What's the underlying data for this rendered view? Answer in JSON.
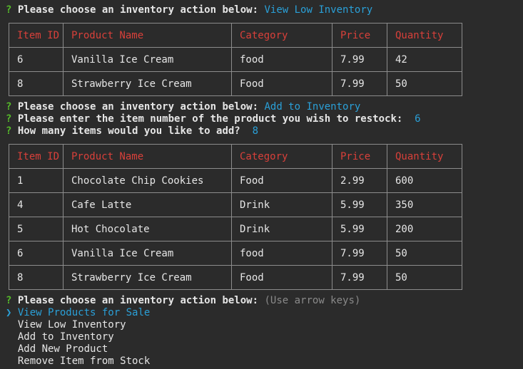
{
  "prompt_mark": "?",
  "selector_mark": "❯",
  "prompt_text": "Please choose an inventory action below:",
  "section1": {
    "answer": "View Low Inventory",
    "table": {
      "headers": [
        "Item ID",
        "Product Name",
        "Category",
        "Price",
        "Quantity"
      ],
      "rows": [
        [
          "6",
          "Vanilla Ice Cream",
          "food",
          "7.99",
          "42"
        ],
        [
          "8",
          "Strawberry Ice Cream",
          "Food",
          "7.99",
          "50"
        ]
      ]
    }
  },
  "section2": {
    "answer": "Add to Inventory",
    "restock_prompt": "Please enter the item number of the product you wish to restock:",
    "restock_answer": "6",
    "add_prompt": "How many items would you like to add?",
    "add_answer": "8",
    "table": {
      "headers": [
        "Item ID",
        "Product Name",
        "Category",
        "Price",
        "Quantity"
      ],
      "rows": [
        [
          "1",
          "Chocolate Chip Cookies",
          "Food",
          "2.99",
          "600"
        ],
        [
          "4",
          "Cafe Latte",
          "Drink",
          "5.99",
          "350"
        ],
        [
          "5",
          "Hot Chocolate",
          "Drink",
          "5.99",
          "200"
        ],
        [
          "6",
          "Vanilla Ice Cream",
          "food",
          "7.99",
          "50"
        ],
        [
          "8",
          "Strawberry Ice Cream",
          "Food",
          "7.99",
          "50"
        ]
      ]
    }
  },
  "section3": {
    "hint": "(Use arrow keys)",
    "options": [
      "View Products for Sale",
      "View Low Inventory",
      "Add to Inventory",
      "Add New Product",
      "Remove Item from Stock"
    ],
    "selected_index": 0
  },
  "colors": {
    "background": "#2b2b2b",
    "prompt_mark": "#55b82a",
    "answer": "#2aa0d8",
    "header": "#d8403a",
    "border": "#8c8c8c"
  }
}
